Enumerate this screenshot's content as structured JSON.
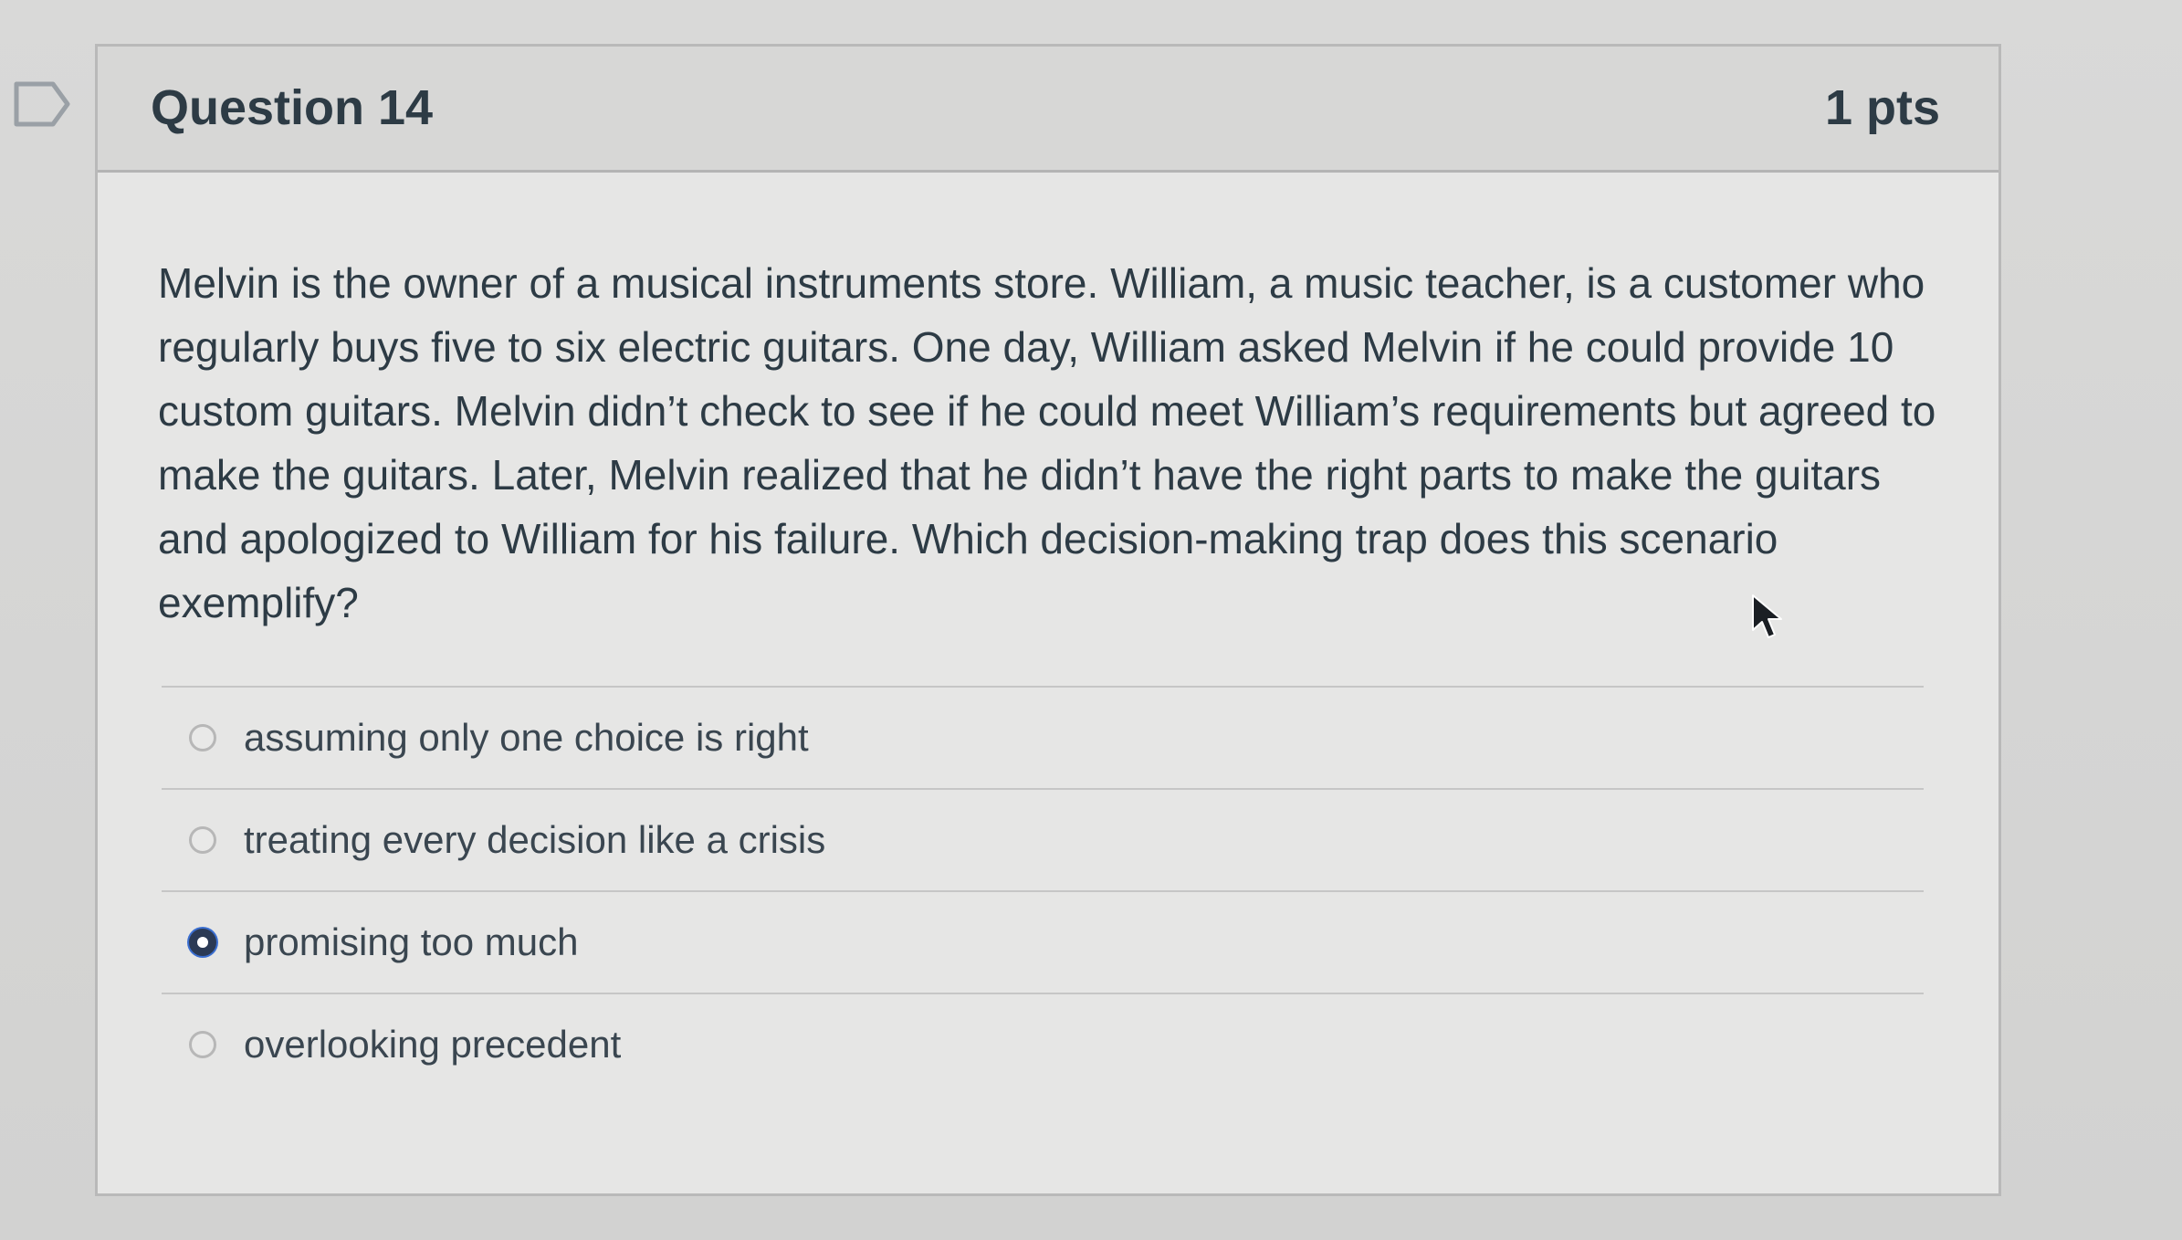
{
  "question": {
    "title": "Question 14",
    "points": "1 pts",
    "text": "Melvin is the owner of a musical instruments store. William, a music teacher, is a customer who regularly buys five to six electric guitars. One day, William asked Melvin if he could provide 10 custom guitars. Melvin didn’t check to see if he could meet William’s requirements but agreed to make the guitars. Later, Melvin realized that he didn’t have the right parts to make the guitars and apologized to William for his failure. Which decision-making trap does this scenario exemplify?"
  },
  "answers": [
    {
      "label": "assuming only one choice is right",
      "selected": false
    },
    {
      "label": "treating every decision like a crisis",
      "selected": false
    },
    {
      "label": "promising too much",
      "selected": true
    },
    {
      "label": "overlooking precedent",
      "selected": false
    }
  ],
  "icons": {
    "flag": "bookmark-flag-icon",
    "cursor": "mouse-pointer-icon"
  },
  "colors": {
    "text": "#2d3b45",
    "header_bg": "#d7d7d6",
    "selected_radio": "#2b3a55"
  }
}
